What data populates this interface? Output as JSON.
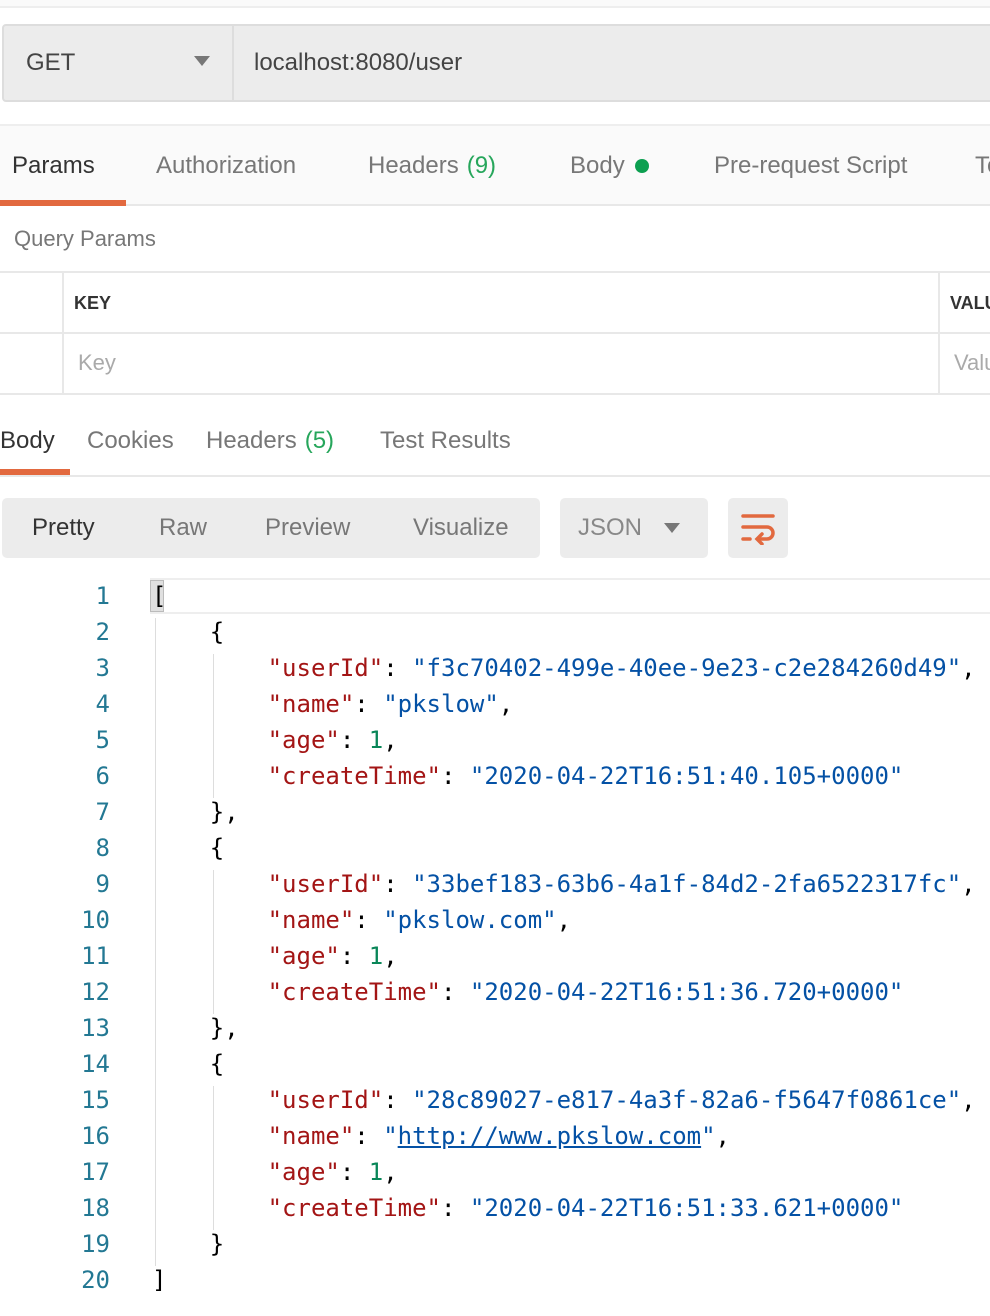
{
  "request": {
    "method": "GET",
    "url": "localhost:8080/user"
  },
  "request_tabs": [
    {
      "label": "Params",
      "active": true
    },
    {
      "label": "Authorization"
    },
    {
      "label": "Headers",
      "count": "(9)"
    },
    {
      "label": "Body",
      "indicator": "green-dot"
    },
    {
      "label": "Pre-request Script"
    },
    {
      "label": "Te"
    }
  ],
  "query_params": {
    "title": "Query Params",
    "key_header": "KEY",
    "value_header": "VALU",
    "key_placeholder": "Key",
    "value_placeholder": "Valu"
  },
  "response_tabs": [
    {
      "label": "Body",
      "active": true
    },
    {
      "label": "Cookies"
    },
    {
      "label": "Headers",
      "count": "(5)"
    },
    {
      "label": "Test Results"
    }
  ],
  "view_modes": [
    "Pretty",
    "Raw",
    "Preview",
    "Visualize"
  ],
  "active_view": "Pretty",
  "format": "JSON",
  "wrap_icon": "wrap-lines-icon",
  "colors": {
    "accent": "#e2693f",
    "key": "#a31515",
    "string": "#0451a5",
    "number": "#098658",
    "count": "#26a65b"
  },
  "code_lines": [
    [
      [
        "p",
        "["
      ]
    ],
    [
      [
        "p",
        "    {"
      ]
    ],
    [
      [
        "p",
        "        "
      ],
      [
        "k",
        "\"userId\""
      ],
      [
        "p",
        ": "
      ],
      [
        "s",
        "\"f3c70402-499e-40ee-9e23-c2e284260d49\""
      ],
      [
        "p",
        ","
      ]
    ],
    [
      [
        "p",
        "        "
      ],
      [
        "k",
        "\"name\""
      ],
      [
        "p",
        ": "
      ],
      [
        "s",
        "\"pkslow\""
      ],
      [
        "p",
        ","
      ]
    ],
    [
      [
        "p",
        "        "
      ],
      [
        "k",
        "\"age\""
      ],
      [
        "p",
        ": "
      ],
      [
        "n",
        "1"
      ],
      [
        "p",
        ","
      ]
    ],
    [
      [
        "p",
        "        "
      ],
      [
        "k",
        "\"createTime\""
      ],
      [
        "p",
        ": "
      ],
      [
        "s",
        "\"2020-04-22T16:51:40.105+0000\""
      ]
    ],
    [
      [
        "p",
        "    },"
      ]
    ],
    [
      [
        "p",
        "    {"
      ]
    ],
    [
      [
        "p",
        "        "
      ],
      [
        "k",
        "\"userId\""
      ],
      [
        "p",
        ": "
      ],
      [
        "s",
        "\"33bef183-63b6-4a1f-84d2-2fa6522317fc\""
      ],
      [
        "p",
        ","
      ]
    ],
    [
      [
        "p",
        "        "
      ],
      [
        "k",
        "\"name\""
      ],
      [
        "p",
        ": "
      ],
      [
        "s",
        "\"pkslow.com\""
      ],
      [
        "p",
        ","
      ]
    ],
    [
      [
        "p",
        "        "
      ],
      [
        "k",
        "\"age\""
      ],
      [
        "p",
        ": "
      ],
      [
        "n",
        "1"
      ],
      [
        "p",
        ","
      ]
    ],
    [
      [
        "p",
        "        "
      ],
      [
        "k",
        "\"createTime\""
      ],
      [
        "p",
        ": "
      ],
      [
        "s",
        "\"2020-04-22T16:51:36.720+0000\""
      ]
    ],
    [
      [
        "p",
        "    },"
      ]
    ],
    [
      [
        "p",
        "    {"
      ]
    ],
    [
      [
        "p",
        "        "
      ],
      [
        "k",
        "\"userId\""
      ],
      [
        "p",
        ": "
      ],
      [
        "s",
        "\"28c89027-e817-4a3f-82a6-f5647f0861ce\""
      ],
      [
        "p",
        ","
      ]
    ],
    [
      [
        "p",
        "        "
      ],
      [
        "k",
        "\"name\""
      ],
      [
        "p",
        ": "
      ],
      [
        "s",
        "\""
      ],
      [
        "lnk",
        "http://www.pkslow.com"
      ],
      [
        "s",
        "\""
      ],
      [
        "p",
        ","
      ]
    ],
    [
      [
        "p",
        "        "
      ],
      [
        "k",
        "\"age\""
      ],
      [
        "p",
        ": "
      ],
      [
        "n",
        "1"
      ],
      [
        "p",
        ","
      ]
    ],
    [
      [
        "p",
        "        "
      ],
      [
        "k",
        "\"createTime\""
      ],
      [
        "p",
        ": "
      ],
      [
        "s",
        "\"2020-04-22T16:51:33.621+0000\""
      ]
    ],
    [
      [
        "p",
        "    }"
      ]
    ],
    [
      [
        "p",
        "]"
      ]
    ]
  ]
}
